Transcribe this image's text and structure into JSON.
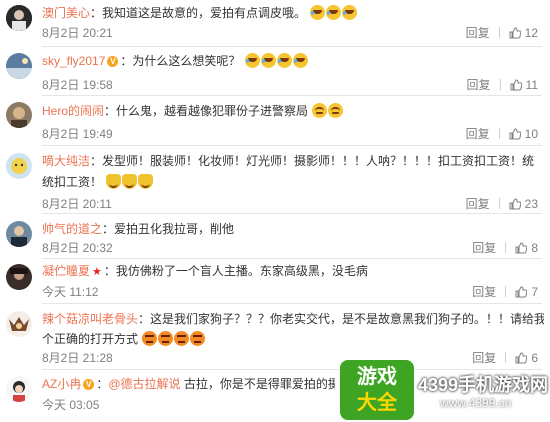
{
  "actions": {
    "reply": "回复"
  },
  "comments": [
    {
      "user": "澳门美心",
      "text": "：我知道这是故意的，爱拍有点调皮哦。",
      "emojis": [
        "laugh",
        "laugh",
        "laugh"
      ],
      "time": "8月2日 20:21",
      "likes": "12"
    },
    {
      "user": "sky_fly2017",
      "text": "：为什么这么想笑呢？",
      "emojis": [
        "laugh",
        "laugh",
        "laugh",
        "laugh"
      ],
      "time": "8月2日 19:58",
      "likes": "11",
      "vip": true
    },
    {
      "user": "Hero的闹闹",
      "text": "：什么鬼，越看越像犯罪份子进警察局",
      "emojis": [
        "sweat",
        "sweat"
      ],
      "time": "8月2日 19:49",
      "likes": "10"
    },
    {
      "user": "嘀大纯洁",
      "text": "：发型师！服装师！化妆师！灯光师！摄影师！！！人呐？！！！扣工资扣工资！统",
      "line2": "统扣工资！",
      "emojis": [
        "cat",
        "cat",
        "cat"
      ],
      "time": "8月2日 20:11",
      "likes": "23"
    },
    {
      "user": "帅气的道之",
      "text": "：爱拍丑化我拉哥，削他",
      "time": "8月2日 20:32",
      "likes": "8"
    },
    {
      "user": "凝伫瞳夏",
      "text": "：我仿佛粉了一个盲人主播。东家高级黑，没毛病",
      "time": "今天 11:12",
      "likes": "7",
      "star": true
    },
    {
      "user": "辣个菇凉叫老骨头",
      "text": "：这是我们家狗子？？？你老实交代，是不是故意黑我们狗子的。！！请给我一",
      "line2": "个正确的打开方式",
      "emojis": [
        "angry",
        "angry",
        "angry",
        "angry"
      ],
      "time": "8月2日 21:28",
      "likes": "6"
    },
    {
      "user": "AZ小冉",
      "text": "：",
      "mention": "@德古拉解说",
      "text2": " 古拉，你是不是得罪爱拍的摄影师了",
      "time": "今天 03:05",
      "vip": true
    }
  ],
  "watermark": {
    "logo_top": "游戏",
    "logo_bottom": "大全",
    "brand": "4399手机游戏网",
    "url": "www.4399.cn"
  },
  "colors": {
    "username": "#eb7350",
    "meta": "#808080",
    "text": "#333333"
  }
}
